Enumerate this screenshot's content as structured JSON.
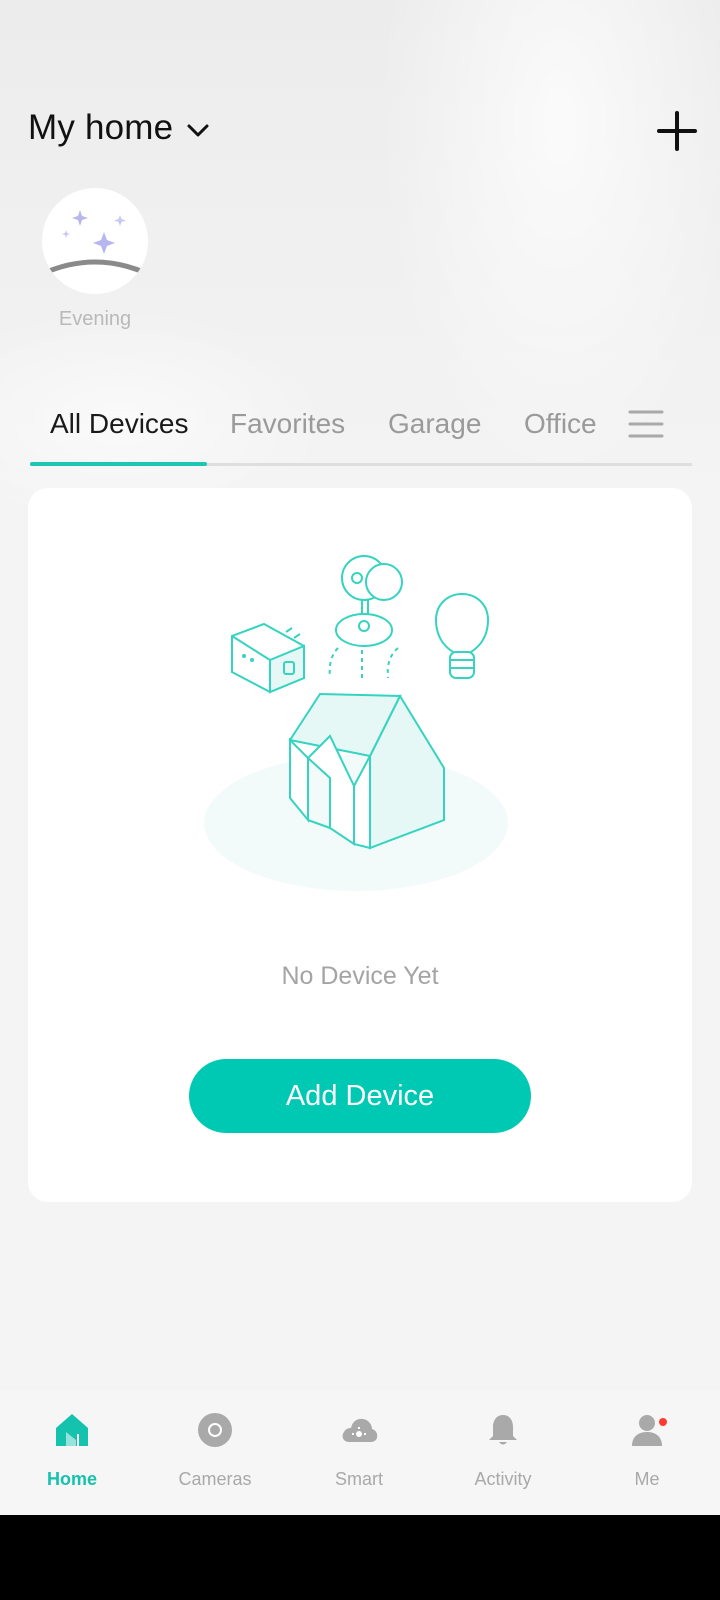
{
  "header": {
    "title": "My home"
  },
  "scene": {
    "label": "Evening"
  },
  "tabs": [
    {
      "label": "All Devices",
      "active": true
    },
    {
      "label": "Favorites",
      "active": false
    },
    {
      "label": "Garage",
      "active": false
    },
    {
      "label": "Office",
      "active": false
    }
  ],
  "empty_state": {
    "message": "No Device Yet",
    "button_label": "Add Device"
  },
  "bottom_nav": [
    {
      "label": "Home",
      "icon": "home-icon",
      "active": true
    },
    {
      "label": "Cameras",
      "icon": "camera-icon",
      "active": false
    },
    {
      "label": "Smart",
      "icon": "smart-cloud-icon",
      "active": false
    },
    {
      "label": "Activity",
      "icon": "bell-icon",
      "active": false
    },
    {
      "label": "Me",
      "icon": "person-icon",
      "active": false,
      "badge": true
    }
  ],
  "colors": {
    "accent": "#00c9b3",
    "badge": "#ff3b30",
    "inactive": "#a9a9a9"
  }
}
